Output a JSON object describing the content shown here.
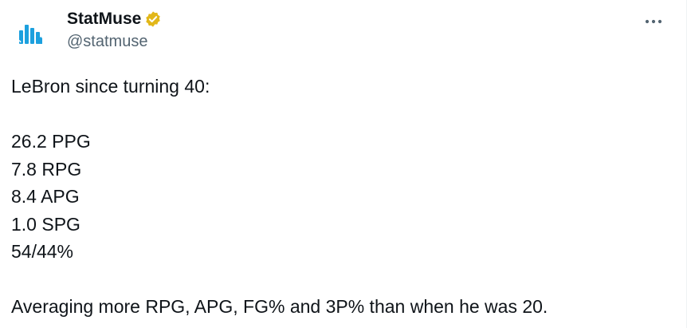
{
  "author": {
    "display_name": "StatMuse",
    "handle": "@statmuse",
    "verified": true,
    "verified_badge_color": "#E2B719",
    "avatar_icon": "statmuse-logo-icon",
    "avatar_color": "#1ca0de"
  },
  "more_icon": "more-options-icon",
  "tweet": {
    "intro": "LeBron since turning 40:",
    "stats": [
      "26.2 PPG",
      "7.8 RPG",
      "8.4 APG",
      "1.0 SPG",
      "54/44%"
    ],
    "closing": "Averaging more RPG, APG, FG% and 3P% than when he was 20."
  },
  "colors": {
    "text": "#0f1419",
    "secondary_text": "#536471"
  }
}
